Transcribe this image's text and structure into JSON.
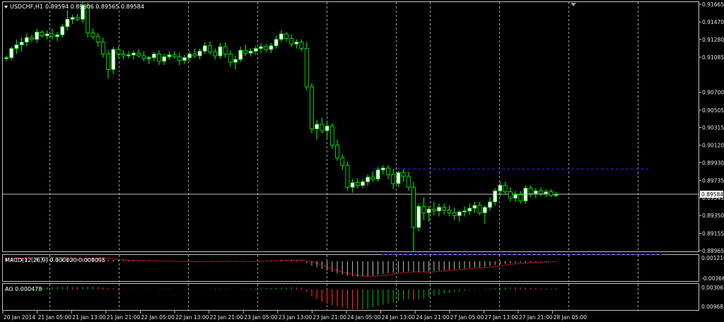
{
  "window": {
    "symbol_title": "USDCHF,H1",
    "ohlc": "0.89594 0.89606 0.89565 0.89584",
    "current_price": "0.89584"
  },
  "panes": {
    "macd_label": "MACD(12,26,9) 0.000020 0.000095",
    "ao_label": "AO 0.000478"
  },
  "price_axis": [
    "0.91665",
    "0.91470",
    "0.91280",
    "0.91085",
    "0.90700",
    "0.90505",
    "0.90315",
    "0.90120",
    "0.89930",
    "0.89735",
    "0.89545",
    "0.89350",
    "0.89155",
    "0.88965"
  ],
  "macd_axis": [
    "0.001216",
    "-0.003665"
  ],
  "ao_axis": [
    "0.003067",
    "0.00968"
  ],
  "time_axis": [
    "20 Jan 2014",
    "21 Jan 05:00",
    "21 Jan 13:00",
    "21 Jan 21:00",
    "22 Jan 05:00",
    "22 Jan 13:00",
    "22 Jan 21:00",
    "23 Jan 05:00",
    "23 Jan 13:00",
    "23 Jan 21:00",
    "24 Jan 05:00",
    "24 Jan 13:00",
    "24 Jan 21:00",
    "27 Jan 05:00",
    "27 Jan 13:00",
    "27 Jan 21:00",
    "28 Jan 05:00"
  ],
  "colors": {
    "background": "#000000",
    "candle_bull": "#ffffff",
    "candle_bear": "#000000",
    "wick": "#00ff00",
    "grid": "#c0c0c0",
    "channel": "#1c1cff",
    "price_line": "#c0c0c0",
    "macd_hist": "#c0c0c0",
    "macd_signal": "#ff2020",
    "ao_up": "#00a000",
    "ao_down": "#ff2020"
  },
  "chart_data": {
    "type": "candlestick",
    "y_range": [
      0.88965,
      0.91665
    ],
    "channel": {
      "upper": 0.8986,
      "lower": 0.8892
    },
    "candles": [
      [
        0.9107,
        0.911,
        0.9104,
        0.9108
      ],
      [
        0.9108,
        0.912,
        0.9105,
        0.9118
      ],
      [
        0.9118,
        0.9128,
        0.9112,
        0.9122
      ],
      [
        0.9122,
        0.913,
        0.9115,
        0.9125
      ],
      [
        0.9125,
        0.9135,
        0.912,
        0.913
      ],
      [
        0.913,
        0.9133,
        0.9125,
        0.9128
      ],
      [
        0.9128,
        0.914,
        0.9124,
        0.9136
      ],
      [
        0.9136,
        0.9138,
        0.913,
        0.9132
      ],
      [
        0.9132,
        0.9138,
        0.9128,
        0.9134
      ],
      [
        0.9134,
        0.914,
        0.9128,
        0.9131
      ],
      [
        0.9131,
        0.9136,
        0.9126,
        0.9133
      ],
      [
        0.9133,
        0.9145,
        0.913,
        0.9142
      ],
      [
        0.9142,
        0.916,
        0.9138,
        0.915
      ],
      [
        0.915,
        0.9155,
        0.9145,
        0.9152
      ],
      [
        0.9152,
        0.9156,
        0.9148,
        0.915
      ],
      [
        0.915,
        0.917,
        0.9146,
        0.9165
      ],
      [
        0.9165,
        0.9168,
        0.913,
        0.9135
      ],
      [
        0.9135,
        0.914,
        0.9128,
        0.9131
      ],
      [
        0.9131,
        0.9135,
        0.912,
        0.9125
      ],
      [
        0.9125,
        0.913,
        0.9108,
        0.9112
      ],
      [
        0.9112,
        0.9116,
        0.9085,
        0.9095
      ],
      [
        0.9095,
        0.912,
        0.909,
        0.9117
      ],
      [
        0.9117,
        0.912,
        0.9108,
        0.9112
      ],
      [
        0.9112,
        0.9116,
        0.9106,
        0.911
      ],
      [
        0.911,
        0.9115,
        0.9107,
        0.9111
      ],
      [
        0.9111,
        0.9116,
        0.9106,
        0.9113
      ],
      [
        0.9113,
        0.9117,
        0.9108,
        0.911
      ],
      [
        0.911,
        0.9115,
        0.9104,
        0.9107
      ],
      [
        0.9107,
        0.911,
        0.9101,
        0.9108
      ],
      [
        0.9108,
        0.9114,
        0.9104,
        0.9112
      ],
      [
        0.9112,
        0.9116,
        0.91,
        0.9104
      ],
      [
        0.9104,
        0.9112,
        0.91,
        0.9109
      ],
      [
        0.9109,
        0.9115,
        0.9106,
        0.9111
      ],
      [
        0.9111,
        0.9115,
        0.9107,
        0.9109
      ],
      [
        0.9109,
        0.9114,
        0.91,
        0.9105
      ],
      [
        0.9105,
        0.9111,
        0.9101,
        0.9108
      ],
      [
        0.9108,
        0.9115,
        0.9104,
        0.9112
      ],
      [
        0.9112,
        0.9118,
        0.9108,
        0.911
      ],
      [
        0.911,
        0.9118,
        0.9106,
        0.9115
      ],
      [
        0.9115,
        0.9125,
        0.9112,
        0.9121
      ],
      [
        0.9121,
        0.9126,
        0.9111,
        0.9114
      ],
      [
        0.9114,
        0.9118,
        0.9106,
        0.911
      ],
      [
        0.911,
        0.9124,
        0.9107,
        0.912
      ],
      [
        0.912,
        0.9125,
        0.9108,
        0.9112
      ],
      [
        0.9112,
        0.9116,
        0.9098,
        0.9103
      ],
      [
        0.9103,
        0.911,
        0.9095,
        0.9106
      ],
      [
        0.9106,
        0.912,
        0.9103,
        0.9116
      ],
      [
        0.9116,
        0.9122,
        0.911,
        0.9113
      ],
      [
        0.9113,
        0.9118,
        0.9109,
        0.9115
      ],
      [
        0.9115,
        0.9121,
        0.9111,
        0.9118
      ],
      [
        0.9118,
        0.9124,
        0.9113,
        0.912
      ],
      [
        0.912,
        0.9123,
        0.9114,
        0.9117
      ],
      [
        0.9117,
        0.9124,
        0.9113,
        0.9121
      ],
      [
        0.9121,
        0.9132,
        0.9118,
        0.9128
      ],
      [
        0.9128,
        0.9138,
        0.9125,
        0.9134
      ],
      [
        0.9134,
        0.9136,
        0.9126,
        0.9129
      ],
      [
        0.9129,
        0.9133,
        0.912,
        0.9123
      ],
      [
        0.9123,
        0.9128,
        0.9118,
        0.9125
      ],
      [
        0.9125,
        0.9128,
        0.9115,
        0.9118
      ],
      [
        0.9118,
        0.9125,
        0.9072,
        0.9076
      ],
      [
        0.9076,
        0.908,
        0.9025,
        0.903
      ],
      [
        0.903,
        0.904,
        0.9018,
        0.9035
      ],
      [
        0.9035,
        0.9042,
        0.9025,
        0.9028
      ],
      [
        0.9028,
        0.9038,
        0.902,
        0.9033
      ],
      [
        0.9033,
        0.9036,
        0.9008,
        0.9012
      ],
      [
        0.9012,
        0.9018,
        0.8995,
        0.8998
      ],
      [
        0.8998,
        0.9002,
        0.8985,
        0.899
      ],
      [
        0.899,
        0.8994,
        0.8962,
        0.8966
      ],
      [
        0.8966,
        0.8975,
        0.896,
        0.8971
      ],
      [
        0.8971,
        0.8976,
        0.8965,
        0.8968
      ],
      [
        0.8968,
        0.8975,
        0.8965,
        0.8972
      ],
      [
        0.8972,
        0.898,
        0.8968,
        0.8977
      ],
      [
        0.8977,
        0.8983,
        0.8972,
        0.8975
      ],
      [
        0.8975,
        0.8988,
        0.8972,
        0.8985
      ],
      [
        0.8985,
        0.899,
        0.898,
        0.8987
      ],
      [
        0.8987,
        0.899,
        0.8975,
        0.898
      ],
      [
        0.898,
        0.8986,
        0.8964,
        0.897
      ],
      [
        0.897,
        0.8984,
        0.8966,
        0.8982
      ],
      [
        0.8982,
        0.8986,
        0.8972,
        0.8978
      ],
      [
        0.8978,
        0.8983,
        0.8962,
        0.8966
      ],
      [
        0.8966,
        0.8972,
        0.8895,
        0.8922
      ],
      [
        0.8922,
        0.8948,
        0.8918,
        0.8945
      ],
      [
        0.8945,
        0.8955,
        0.893,
        0.8938
      ],
      [
        0.8938,
        0.8945,
        0.8928,
        0.8942
      ],
      [
        0.8942,
        0.895,
        0.8935,
        0.894
      ],
      [
        0.894,
        0.8948,
        0.8934,
        0.8944
      ],
      [
        0.8944,
        0.8948,
        0.8936,
        0.8941
      ],
      [
        0.8941,
        0.8946,
        0.8934,
        0.8938
      ],
      [
        0.8938,
        0.8944,
        0.893,
        0.8935
      ],
      [
        0.8935,
        0.8941,
        0.8928,
        0.8939
      ],
      [
        0.8939,
        0.8945,
        0.8934,
        0.894
      ],
      [
        0.894,
        0.8948,
        0.8936,
        0.8943
      ],
      [
        0.8943,
        0.895,
        0.8938,
        0.8946
      ],
      [
        0.8946,
        0.895,
        0.8935,
        0.8938
      ],
      [
        0.8938,
        0.8946,
        0.8926,
        0.8944
      ],
      [
        0.8944,
        0.8955,
        0.894,
        0.895
      ],
      [
        0.895,
        0.8965,
        0.8946,
        0.8962
      ],
      [
        0.8962,
        0.8972,
        0.8956,
        0.8968
      ],
      [
        0.8968,
        0.8972,
        0.8958,
        0.8961
      ],
      [
        0.8961,
        0.8966,
        0.895,
        0.8954
      ],
      [
        0.8954,
        0.8962,
        0.895,
        0.8958
      ],
      [
        0.8958,
        0.8962,
        0.8948,
        0.8951
      ],
      [
        0.8951,
        0.8968,
        0.8948,
        0.8965
      ],
      [
        0.8965,
        0.8968,
        0.8955,
        0.8959
      ],
      [
        0.8959,
        0.8965,
        0.8954,
        0.8962
      ],
      [
        0.8962,
        0.8966,
        0.8956,
        0.8959
      ],
      [
        0.8959,
        0.8964,
        0.8955,
        0.8961
      ],
      [
        0.8961,
        0.8964,
        0.8955,
        0.8957
      ],
      [
        0.8957,
        0.8961,
        0.8955,
        0.8958
      ]
    ],
    "macd_hist": [
      0.0006,
      0.0006,
      0.0007,
      0.0008,
      0.0009,
      0.0009,
      0.0009,
      0.001,
      0.001,
      0.0009,
      0.0008,
      0.0007,
      0.0006,
      0.0006,
      0.0005,
      0.0006,
      0.0007,
      0.0008,
      0.0008,
      0.0006,
      0.0004,
      0.0003,
      0.0003,
      0.0002,
      0.0002,
      0.0002,
      0.0001,
      0.0001,
      0.0001,
      0.0,
      0.0,
      0.0,
      0.0,
      0.0,
      0.0,
      -0.0001,
      -0.0001,
      -0.0001,
      0.0,
      0.0,
      0.0,
      0.0,
      0.0,
      0.0,
      0.0,
      -0.0001,
      -0.0001,
      0.0,
      0.0,
      0.0,
      0.0001,
      0.0001,
      0.0001,
      0.0002,
      0.0003,
      0.0003,
      0.0003,
      0.0002,
      0.0001,
      -0.0004,
      -0.001,
      -0.0014,
      -0.0018,
      -0.0022,
      -0.0025,
      -0.0028,
      -0.0031,
      -0.0034,
      -0.0035,
      -0.0036,
      -0.0036,
      -0.0035,
      -0.0034,
      -0.0032,
      -0.003,
      -0.0028,
      -0.0027,
      -0.0026,
      -0.0025,
      -0.0024,
      -0.0026,
      -0.0026,
      -0.0025,
      -0.0024,
      -0.0023,
      -0.0022,
      -0.0021,
      -0.002,
      -0.0019,
      -0.0018,
      -0.0017,
      -0.0016,
      -0.0015,
      -0.0014,
      -0.0013,
      -0.0011,
      -0.0009,
      -0.0007,
      -0.0006,
      -0.0005,
      -0.0004,
      -0.0003,
      -0.0003,
      -0.0002,
      -0.0002,
      -0.0001,
      -0.0001,
      0.0,
      0.0
    ],
    "ao": [
      0.0003,
      0.0004,
      0.0004,
      0.0005,
      0.0006,
      0.0007,
      0.0008,
      0.0009,
      0.001,
      0.0011,
      0.0012,
      0.0013,
      0.0013,
      0.0012,
      0.0011,
      0.0012,
      0.0013,
      0.0014,
      0.0012,
      0.001,
      0.0008,
      0.0006,
      0.0004,
      0.0002,
      0.0001,
      0.0001,
      0.0,
      -0.0001,
      -0.0001,
      0.0,
      0.0001,
      0.0002,
      0.0002,
      0.0001,
      0.0,
      -0.0001,
      -0.0002,
      -0.0001,
      0.0,
      0.0001,
      0.0002,
      0.0003,
      0.0003,
      0.0002,
      0.0001,
      0.0,
      0.0001,
      0.0002,
      0.0003,
      0.0004,
      0.0005,
      0.0006,
      0.0007,
      0.0008,
      0.0009,
      0.001,
      0.0011,
      0.001,
      0.0008,
      -0.001,
      -0.003,
      -0.0045,
      -0.0058,
      -0.0068,
      -0.0075,
      -0.008,
      -0.0085,
      -0.009,
      -0.0094,
      -0.0096,
      -0.0095,
      -0.009,
      -0.0084,
      -0.0078,
      -0.0072,
      -0.0066,
      -0.006,
      -0.0055,
      -0.005,
      -0.0046,
      -0.005,
      -0.0047,
      -0.0042,
      -0.0036,
      -0.003,
      -0.0025,
      -0.002,
      -0.0016,
      -0.0012,
      -0.0009,
      -0.0006,
      -0.0004,
      -0.0002,
      0.0,
      0.0002,
      0.0004,
      0.0006,
      0.0008,
      0.001,
      0.0011,
      0.001,
      0.0009,
      0.0008,
      0.0007,
      0.0006,
      0.0005,
      0.0005,
      0.0004,
      0.0005
    ]
  }
}
